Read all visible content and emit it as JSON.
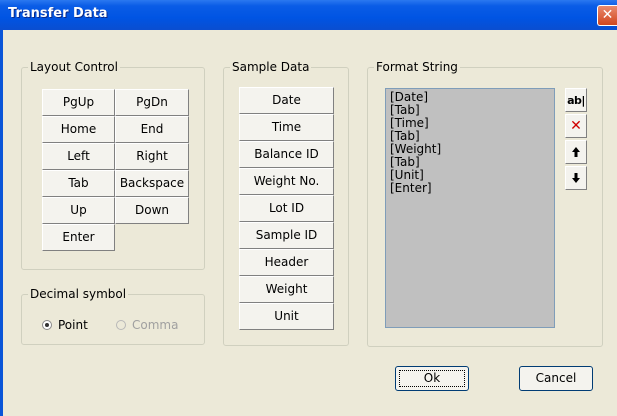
{
  "window": {
    "title": "Transfer Data",
    "close_glyph": "✕"
  },
  "layout_control": {
    "legend": "Layout Control",
    "buttons": [
      "PgUp",
      "PgDn",
      "Home",
      "End",
      "Left",
      "Right",
      "Tab",
      "Backspace",
      "Up",
      "Down",
      "Enter"
    ]
  },
  "decimal_symbol": {
    "legend": "Decimal symbol",
    "options": [
      {
        "label": "Point",
        "checked": true,
        "enabled": true
      },
      {
        "label": "Comma",
        "checked": false,
        "enabled": false
      }
    ]
  },
  "sample_data": {
    "legend": "Sample Data",
    "buttons": [
      "Date",
      "Time",
      "Balance ID",
      "Weight No.",
      "Lot ID",
      "Sample ID",
      "Header",
      "Weight",
      "Unit"
    ]
  },
  "format_string": {
    "legend": "Format String",
    "lines": [
      "[Date]",
      "[Tab]",
      "[Time]",
      "[Tab]",
      "[Weight]",
      "[Tab]",
      "[Unit]",
      "[Enter]"
    ],
    "tools": [
      {
        "name": "ab-text-icon",
        "glyph": "ab|"
      },
      {
        "name": "delete-x-icon",
        "glyph": "✕"
      },
      {
        "name": "move-up-icon",
        "glyph": "🠉"
      },
      {
        "name": "move-down-icon",
        "glyph": "🠋"
      }
    ]
  },
  "dialog_buttons": {
    "ok": "Ok",
    "cancel": "Cancel"
  },
  "colors": {
    "titlebar": "#0054e3",
    "face": "#ece9d8",
    "format_bg": "#c0c0c0",
    "delete": "#d00000"
  }
}
